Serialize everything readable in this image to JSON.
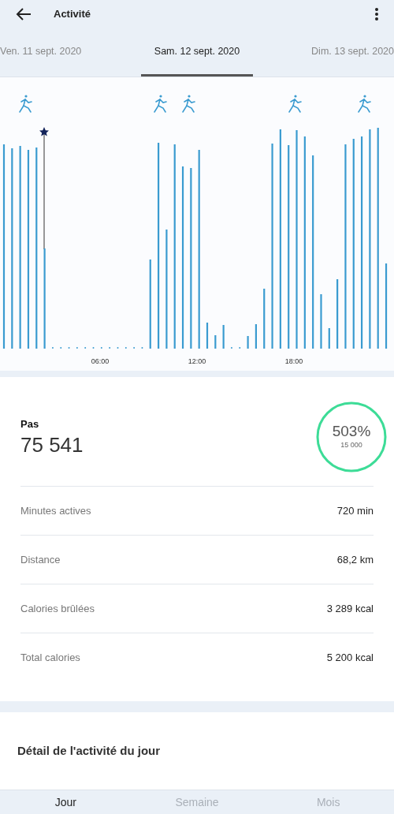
{
  "header": {
    "title": "Activité"
  },
  "date_tabs": [
    {
      "label": "Ven. 11 sept. 2020",
      "selected": false
    },
    {
      "label": "Sam. 12 sept. 2020",
      "selected": true
    },
    {
      "label": "Dim. 13 sept. 2020",
      "selected": false
    }
  ],
  "activity_chart": {
    "time_labels": [
      "06:00",
      "12:00",
      "18:00"
    ]
  },
  "steps": {
    "label": "Pas",
    "value": "75 541",
    "goal_percent": "503%",
    "goal": "15 000",
    "level": 1
  },
  "stats": [
    {
      "label": "Minutes actives",
      "value": "720 min"
    },
    {
      "label": "Distance",
      "value": "68,2 km"
    },
    {
      "label": "Calories brûlées",
      "value": "3 289 kcal"
    },
    {
      "label": "Total calories",
      "value": "5 200 kcal"
    }
  ],
  "detail": {
    "title": "Détail de l'activité du jour"
  },
  "bottom_tabs": [
    {
      "label": "Jour",
      "selected": true
    },
    {
      "label": "Semaine",
      "selected": false
    },
    {
      "label": "Mois",
      "selected": false
    }
  ]
}
